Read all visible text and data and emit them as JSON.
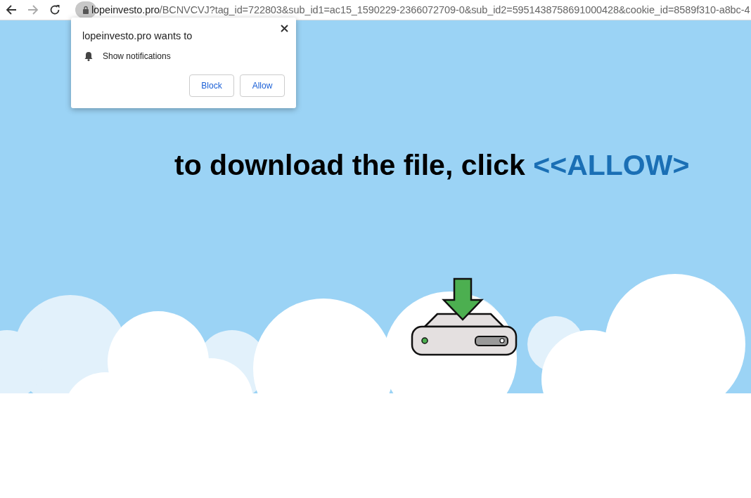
{
  "address_bar": {
    "domain": "lopeinvesto.pro",
    "path": "/BCNVCVJ?tag_id=722803&sub_id1=ac15_1590229-2366072709-0&sub_id2=5951438758691000428&cookie_id=8589f310-a8bc-4"
  },
  "permission_popup": {
    "title": "lopeinvesto.pro wants to",
    "permission": "Show notifications",
    "buttons": [
      {
        "label": "Block"
      },
      {
        "label": "Allow"
      }
    ]
  },
  "headline": {
    "text": "to download the file, click ",
    "highlight": "<<ALLOW>"
  }
}
